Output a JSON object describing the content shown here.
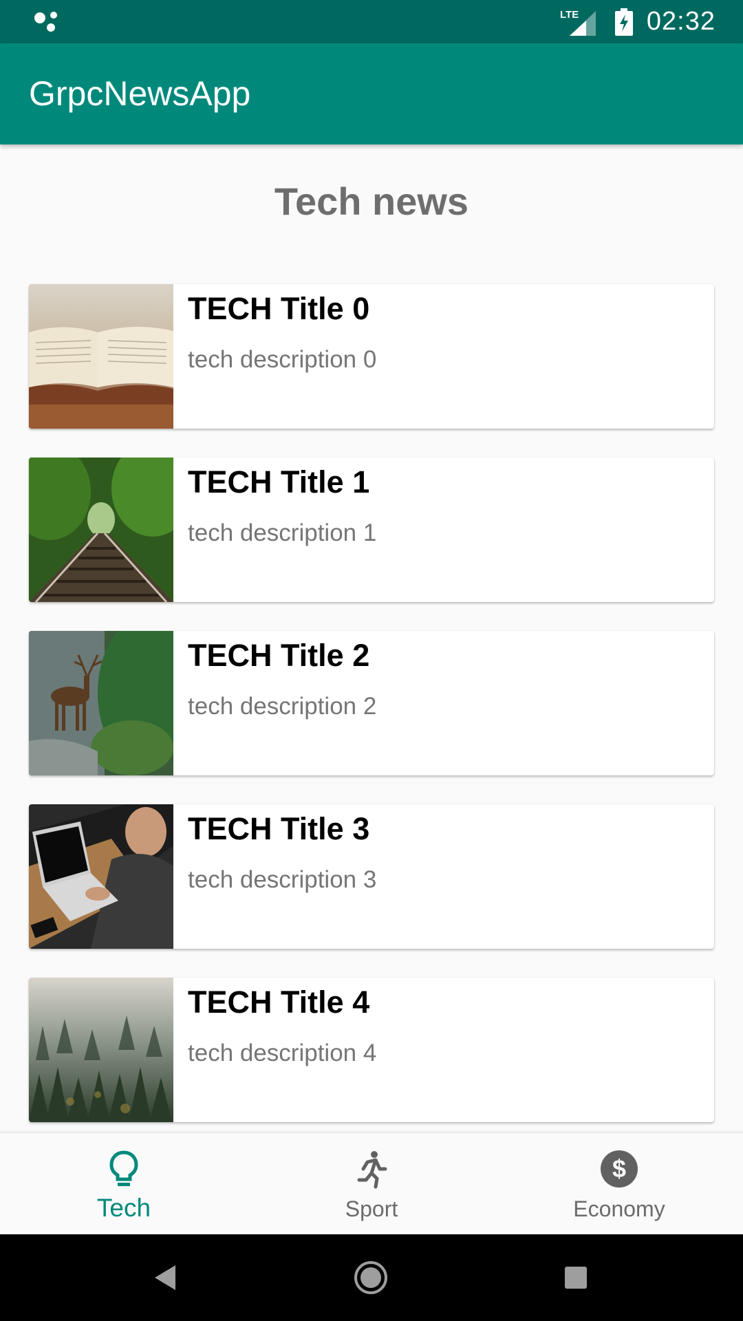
{
  "status_bar": {
    "network": "LTE",
    "time": "02:32"
  },
  "app_bar": {
    "title": "GrpcNewsApp"
  },
  "main": {
    "section_title": "Tech news",
    "articles": [
      {
        "title": "TECH Title 0",
        "description": "tech description 0",
        "image": "open-book-photo"
      },
      {
        "title": "TECH Title 1",
        "description": "tech description 1",
        "image": "railway-forest-photo"
      },
      {
        "title": "TECH Title 2",
        "description": "tech description 2",
        "image": "deer-river-photo"
      },
      {
        "title": "TECH Title 3",
        "description": "tech description 3",
        "image": "laptop-desk-photo"
      },
      {
        "title": "TECH Title 4",
        "description": "tech description 4",
        "image": "foggy-forest-photo"
      }
    ]
  },
  "bottom_nav": {
    "items": [
      {
        "label": "Tech",
        "icon": "lightbulb-icon",
        "active": true
      },
      {
        "label": "Sport",
        "icon": "running-person-icon",
        "active": false
      },
      {
        "label": "Economy",
        "icon": "dollar-icon",
        "active": false
      }
    ]
  },
  "colors": {
    "primary": "#00897b",
    "primary_dark": "#00695f",
    "background": "#fafafa",
    "description_text": "#757575",
    "section_title": "#6e6e6e"
  }
}
